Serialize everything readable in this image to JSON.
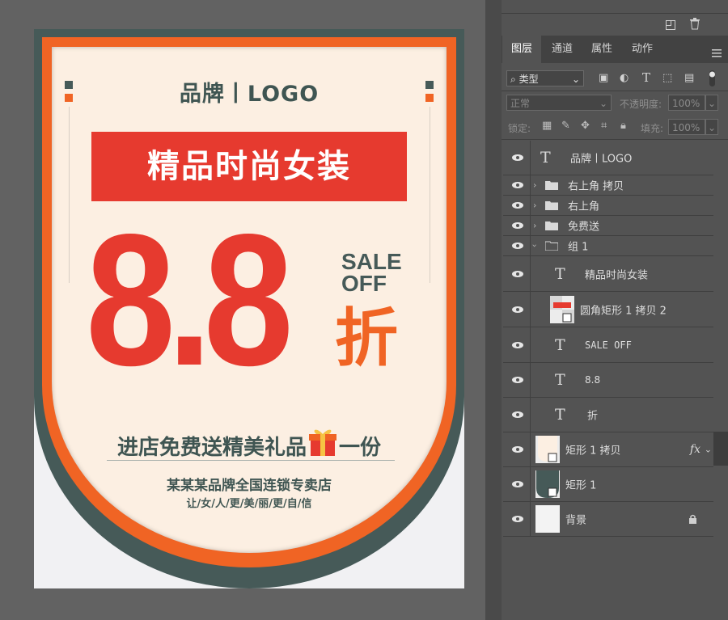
{
  "poster": {
    "brand": "品牌丨LOGO",
    "banner": "精品时尚女装",
    "big_number": "8.8",
    "sale_line1": "SALE",
    "sale_line2": "OFF",
    "zhe": "折",
    "free_gift_before": "进店免费送精美礼品",
    "free_gift_after": "一份",
    "store": "某某某品牌全国连锁专卖店",
    "slogan": "让/女/人/更/美/丽/更/自/信",
    "colors": {
      "dark": "#465a58",
      "orange": "#f06424",
      "cream": "#fcefe2",
      "red": "#e63a2f"
    }
  },
  "panel": {
    "tabs": [
      "图层",
      "通道",
      "属性",
      "动作"
    ],
    "filter_label": "类型",
    "blend_mode": "正常",
    "opacity_label": "不透明度:",
    "opacity_value": "100%",
    "lock_label": "锁定:",
    "fill_label": "填充:",
    "fill_value": "100%",
    "layers": [
      {
        "name": "品牌丨LOGO",
        "kind": "text"
      },
      {
        "name": "右上角 拷贝",
        "kind": "folder"
      },
      {
        "name": "右上角",
        "kind": "folder"
      },
      {
        "name": "免费送",
        "kind": "folder"
      },
      {
        "name": "组 1",
        "kind": "folder-open"
      },
      {
        "name": "精品时尚女装",
        "kind": "text"
      },
      {
        "name": "圆角矩形 1 拷贝 2",
        "kind": "shape"
      },
      {
        "name": "SALE OFF",
        "kind": "text"
      },
      {
        "name": "8.8",
        "kind": "text"
      },
      {
        "name": "折",
        "kind": "text"
      },
      {
        "name": "矩形 1 拷贝",
        "kind": "shape-cream",
        "fx": "fx"
      },
      {
        "name": "矩形 1",
        "kind": "shape-dark"
      },
      {
        "name": "背景",
        "kind": "background"
      }
    ]
  }
}
